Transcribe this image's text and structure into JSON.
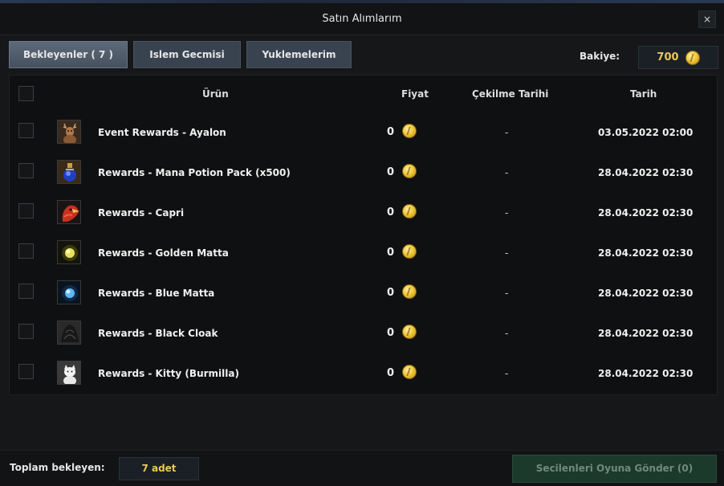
{
  "window": {
    "title": "Satın Alımlarım",
    "close_label": "×"
  },
  "tabs": [
    {
      "label": "Bekleyenler ( 7 )",
      "active": true
    },
    {
      "label": "Islem Gecmisi",
      "active": false
    },
    {
      "label": "Yuklemelerim",
      "active": false
    }
  ],
  "balance": {
    "label": "Bakiye:",
    "value": "700",
    "icon": "gold-coin-icon"
  },
  "table": {
    "headers": {
      "product": "Ürün",
      "price": "Fiyat",
      "draw_date": "Çekilme Tarihi",
      "date": "Tarih"
    },
    "rows": [
      {
        "name": "Event Rewards - Ayalon",
        "price": "0",
        "draw_date": "-",
        "date": "03.05.2022 02:00",
        "icon": "deer-icon"
      },
      {
        "name": "Rewards - Mana Potion Pack (x500)",
        "price": "0",
        "draw_date": "-",
        "date": "28.04.2022 02:30",
        "icon": "mana-potion-icon"
      },
      {
        "name": "Rewards - Capri",
        "price": "0",
        "draw_date": "-",
        "date": "28.04.2022 02:30",
        "icon": "red-bird-icon"
      },
      {
        "name": "Rewards - Golden Matta",
        "price": "0",
        "draw_date": "-",
        "date": "28.04.2022 02:30",
        "icon": "golden-orb-icon"
      },
      {
        "name": "Rewards - Blue Matta",
        "price": "0",
        "draw_date": "-",
        "date": "28.04.2022 02:30",
        "icon": "blue-orb-icon"
      },
      {
        "name": "Rewards - Black Cloak",
        "price": "0",
        "draw_date": "-",
        "date": "28.04.2022 02:30",
        "icon": "black-cloak-icon"
      },
      {
        "name": "Rewards - Kitty (Burmilla)",
        "price": "0",
        "draw_date": "-",
        "date": "28.04.2022 02:30",
        "icon": "kitty-icon"
      }
    ]
  },
  "footer": {
    "total_label": "Toplam bekleyen:",
    "total_value": "7 adet",
    "send_label": "Secilenleri Oyuna Gönder (0)"
  },
  "colors": {
    "accent_gold": "#e8c75a",
    "send_button_bg": "#1c3a2c"
  }
}
